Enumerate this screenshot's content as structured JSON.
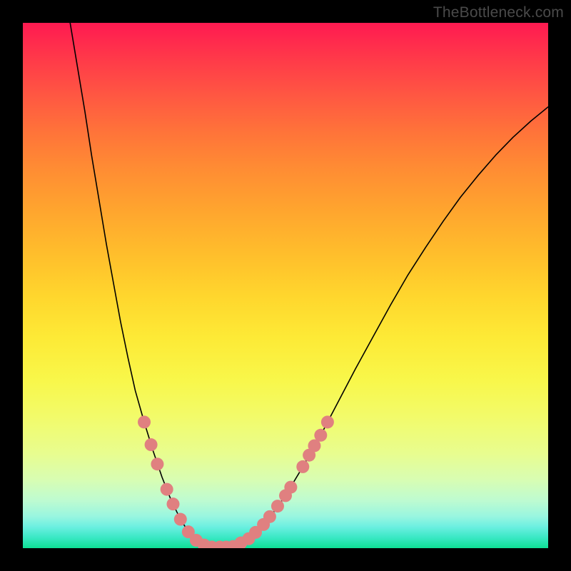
{
  "attribution": "TheBottleneck.com",
  "colors": {
    "curve": "#000000",
    "marker_fill": "#e08080",
    "marker_stroke": "#c06868",
    "gradient_top": "#ff1a51",
    "gradient_bottom": "#0ee094"
  },
  "chart_data": {
    "type": "line",
    "title": "",
    "xlabel": "",
    "ylabel": "",
    "xlim": [
      0,
      100
    ],
    "ylim": [
      0,
      100
    ],
    "grid": false,
    "series": [
      {
        "name": "bottleneck-curve",
        "x": [
          9.0,
          10.4,
          11.8,
          13.1,
          14.5,
          15.9,
          17.3,
          18.6,
          20.0,
          21.4,
          23.1,
          24.8,
          26.5,
          28.2,
          29.9,
          31.5,
          33.2,
          34.9,
          36.6,
          38.3,
          40.0,
          43.3,
          46.7,
          50.0,
          53.3,
          56.7,
          60.0,
          63.3,
          66.7,
          70.0,
          73.3,
          76.7,
          80.0,
          83.3,
          86.7,
          90.0,
          93.3,
          96.7,
          100.0
        ],
        "y": [
          100.0,
          91.6,
          83.2,
          74.7,
          66.3,
          57.9,
          50.2,
          43.1,
          36.3,
          30.0,
          24.0,
          18.5,
          13.5,
          9.2,
          5.7,
          3.1,
          1.4,
          0.5,
          0.2,
          0.2,
          0.3,
          2.0,
          5.4,
          10.0,
          15.5,
          21.5,
          27.8,
          34.1,
          40.3,
          46.3,
          52.0,
          57.3,
          62.2,
          66.8,
          71.0,
          74.8,
          78.2,
          81.3,
          84.0
        ]
      }
    ],
    "annotations": {
      "highlight_markers": {
        "description": "salmon circular markers on curve near minimum",
        "points": [
          {
            "x": 23.1,
            "y": 24.0
          },
          {
            "x": 24.4,
            "y": 19.7
          },
          {
            "x": 25.6,
            "y": 16.0
          },
          {
            "x": 27.4,
            "y": 11.2
          },
          {
            "x": 28.6,
            "y": 8.4
          },
          {
            "x": 30.0,
            "y": 5.5
          },
          {
            "x": 31.5,
            "y": 3.1
          },
          {
            "x": 33.0,
            "y": 1.5
          },
          {
            "x": 34.5,
            "y": 0.6
          },
          {
            "x": 36.0,
            "y": 0.2
          },
          {
            "x": 37.5,
            "y": 0.2
          },
          {
            "x": 38.7,
            "y": 0.2
          },
          {
            "x": 40.0,
            "y": 0.3
          },
          {
            "x": 41.5,
            "y": 1.0
          },
          {
            "x": 43.0,
            "y": 1.8
          },
          {
            "x": 44.3,
            "y": 3.0
          },
          {
            "x": 45.8,
            "y": 4.5
          },
          {
            "x": 47.0,
            "y": 6.0
          },
          {
            "x": 48.5,
            "y": 8.0
          },
          {
            "x": 50.0,
            "y": 10.0
          },
          {
            "x": 51.0,
            "y": 11.6
          },
          {
            "x": 53.3,
            "y": 15.5
          },
          {
            "x": 54.5,
            "y": 17.7
          },
          {
            "x": 55.5,
            "y": 19.5
          },
          {
            "x": 56.7,
            "y": 21.5
          },
          {
            "x": 58.0,
            "y": 24.0
          }
        ]
      }
    }
  }
}
